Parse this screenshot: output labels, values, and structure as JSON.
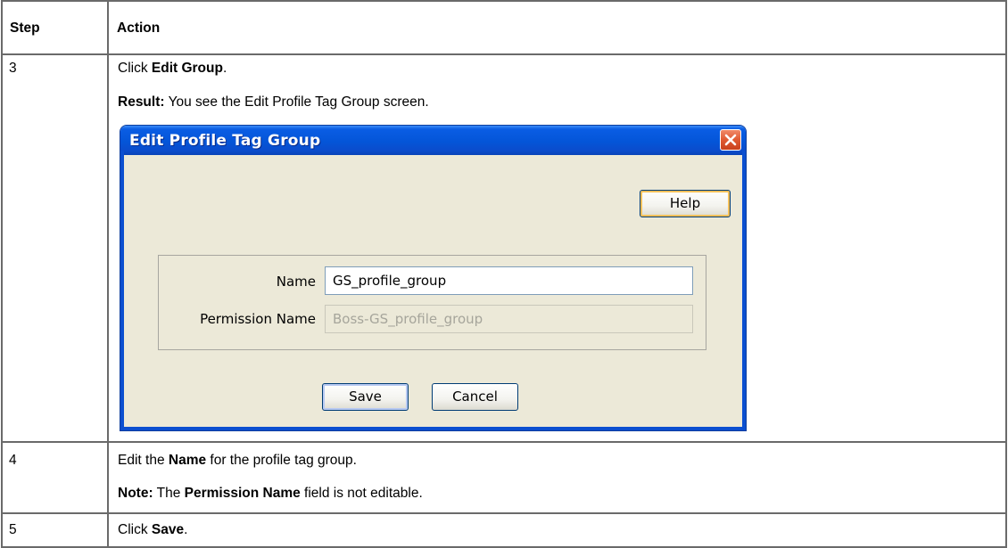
{
  "table": {
    "headers": {
      "step": "Step",
      "action": "Action"
    },
    "rows": [
      {
        "step": "3",
        "line1": {
          "pre": "Click ",
          "bold": "Edit Group",
          "post": "."
        },
        "line2": {
          "bold": "Result:",
          "post": " You see the Edit Profile Tag Group screen."
        }
      },
      {
        "step": "4",
        "line1": {
          "pre": "Edit the ",
          "bold": "Name",
          "post": " for the profile tag group."
        },
        "line2": {
          "bold": "Note:",
          "mid": " The ",
          "bold2": "Permission Name",
          "post": " field is not editable."
        }
      },
      {
        "step": "5",
        "line1": {
          "pre": "Click ",
          "bold": "Save",
          "post": "."
        }
      }
    ]
  },
  "dialog": {
    "title": "Edit Profile Tag Group",
    "help_label": "Help",
    "fields": {
      "name_label": "Name",
      "name_value": "GS_profile_group",
      "permission_label": "Permission Name",
      "permission_value": "Boss-GS_profile_group"
    },
    "save_label": "Save",
    "cancel_label": "Cancel"
  },
  "icons": {
    "close": "close-icon"
  },
  "colors": {
    "titlebar": "#0455d8",
    "close_button": "#e05a32",
    "dialog_body": "#ece9d8"
  }
}
